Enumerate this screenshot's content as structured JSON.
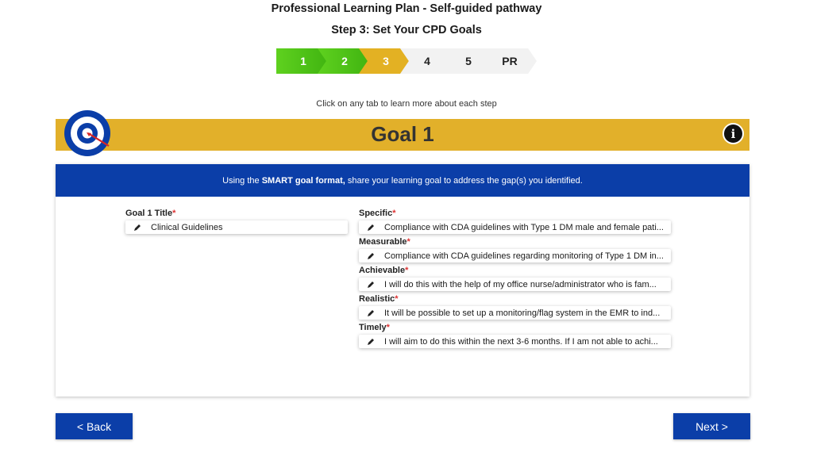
{
  "header": {
    "title": "Professional Learning Plan - Self-guided pathway",
    "step_title": "Step 3: Set Your CPD Goals"
  },
  "stepper": {
    "steps": [
      {
        "label": "1",
        "state": "done"
      },
      {
        "label": "2",
        "state": "done"
      },
      {
        "label": "3",
        "state": "active"
      },
      {
        "label": "4",
        "state": "todo"
      },
      {
        "label": "5",
        "state": "todo"
      },
      {
        "label": "PR",
        "state": "todo"
      }
    ],
    "hint": "Click on any tab to learn more about each step"
  },
  "goal": {
    "heading": "Goal 1",
    "info_icon": "info-icon",
    "target_icon": "target-icon"
  },
  "banner": {
    "prefix": "Using the ",
    "bold": "SMART goal format,",
    "suffix": " share your learning goal to address the gap(s) you identified."
  },
  "form": {
    "title_label": "Goal 1 Title",
    "title_value": "Clinical Guidelines",
    "specific_label": "Specific",
    "specific_value": "Compliance with CDA guidelines with Type 1 DM male and female pati...",
    "measurable_label": "Measurable",
    "measurable_value": "Compliance with CDA guidelines regarding monitoring of Type 1 DM in...",
    "achievable_label": "Achievable",
    "achievable_value": "I will do this with the help of my office nurse/administrator who is fam...",
    "realistic_label": "Realistic",
    "realistic_value": "It will be possible to set up a monitoring/flag system in the EMR to ind...",
    "timely_label": "Timely",
    "timely_value": "I will aim to do this within the next 3-6 months. If I am not able to achi...",
    "required_mark": "*"
  },
  "nav": {
    "back_label": "< Back",
    "next_label": "Next >"
  },
  "colors": {
    "brand_blue": "#0b3ea8",
    "goal_gold": "#e2b02a",
    "done_green": "#4cc016",
    "required_red": "#d33333"
  }
}
